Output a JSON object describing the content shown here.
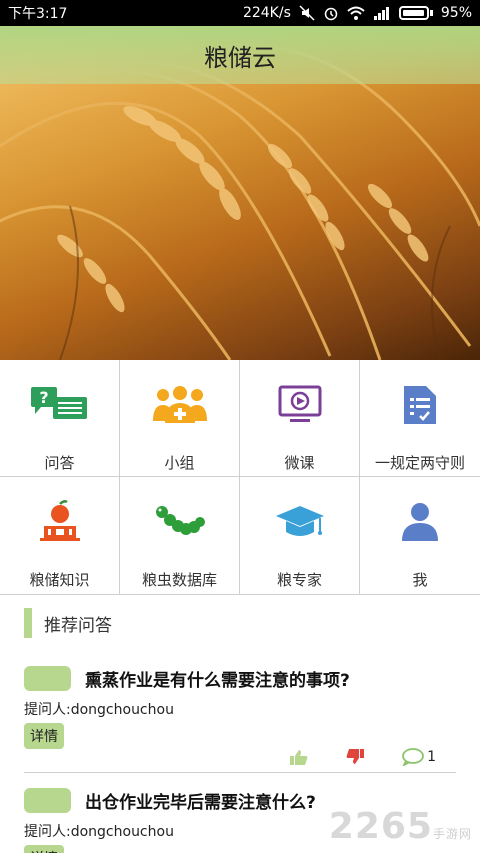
{
  "status_bar": {
    "time": "下午3:17",
    "speed": "224K/s",
    "battery": "95%"
  },
  "app": {
    "title": "粮储云"
  },
  "grid": [
    {
      "label": "问答",
      "icon": "chat-question-icon"
    },
    {
      "label": "小组",
      "icon": "group-add-icon"
    },
    {
      "label": "微课",
      "icon": "video-screen-icon"
    },
    {
      "label": "一规定两守则",
      "icon": "document-checklist-icon"
    },
    {
      "label": "粮储知识",
      "icon": "apple-book-icon"
    },
    {
      "label": "粮虫数据库",
      "icon": "caterpillar-icon"
    },
    {
      "label": "粮专家",
      "icon": "graduation-cap-icon"
    },
    {
      "label": "我",
      "icon": "user-icon"
    }
  ],
  "section": {
    "title": "推荐问答"
  },
  "questions": [
    {
      "title": "熏蒸作业是有什么需要注意的事项?",
      "asker": "提问人:dongchouchou",
      "detail": "详情",
      "comments": "1"
    },
    {
      "title": "出仓作业完毕后需要注意什么?",
      "asker": "提问人:dongchouchou",
      "detail": "详情"
    }
  ],
  "watermark": {
    "brand": "2265",
    "sub": "手游网"
  },
  "colors": {
    "accent_green": "#b7d68e",
    "banner_gold": "#d99633"
  }
}
